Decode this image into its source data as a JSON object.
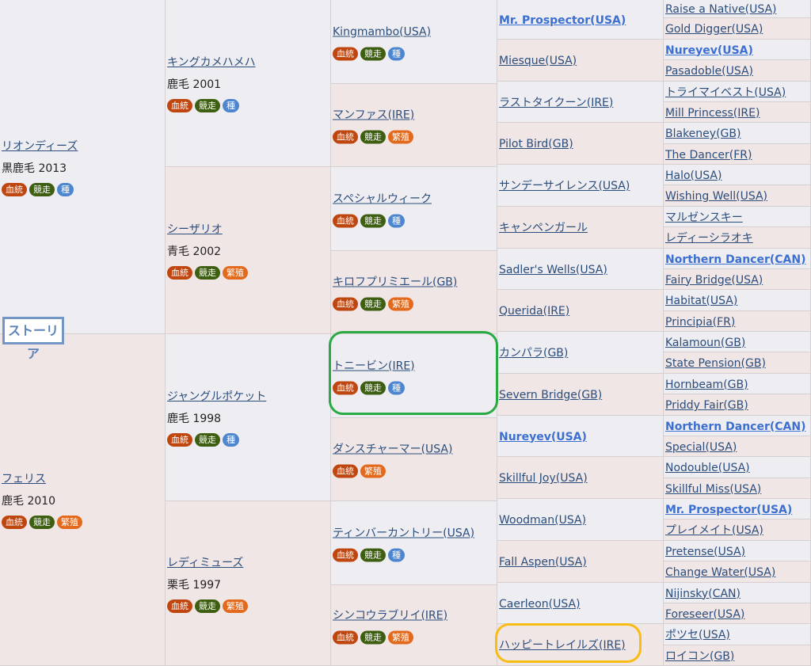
{
  "subject_label": "ストーリア",
  "gen1": [
    {
      "name": "リオンディーズ",
      "coat": "黒鹿毛 2013",
      "badges": [
        "血統",
        "競走",
        "種"
      ]
    },
    {
      "name": "フェリス",
      "coat": "鹿毛 2010",
      "badges": [
        "血統",
        "競走",
        "繁殖"
      ]
    }
  ],
  "gen2": [
    {
      "name": "キングカメハメハ",
      "coat": "鹿毛 2001",
      "badges": [
        "血統",
        "競走",
        "種"
      ]
    },
    {
      "name": "シーザリオ",
      "coat": "青毛 2002",
      "badges": [
        "血統",
        "競走",
        "繁殖"
      ]
    },
    {
      "name": "ジャングルポケット",
      "coat": "鹿毛 1998",
      "badges": [
        "血統",
        "競走",
        "種"
      ]
    },
    {
      "name": "レディミューズ",
      "coat": "栗毛 1997",
      "badges": [
        "血統",
        "競走",
        "繁殖"
      ]
    }
  ],
  "gen3": [
    {
      "name": "Kingmambo(USA)",
      "badges": [
        "血統",
        "競走",
        "種"
      ]
    },
    {
      "name": "マンファス(IRE)",
      "badges": [
        "血統",
        "競走",
        "繁殖"
      ]
    },
    {
      "name": "スペシャルウィーク",
      "badges": [
        "血統",
        "競走",
        "種"
      ]
    },
    {
      "name": "キロフプリミエール(GB)",
      "badges": [
        "血統",
        "競走",
        "繁殖"
      ]
    },
    {
      "name": "トニービン(IRE)",
      "badges": [
        "血統",
        "競走",
        "種"
      ]
    },
    {
      "name": "ダンスチャーマー(USA)",
      "badges": [
        "血統",
        "繁殖"
      ]
    },
    {
      "name": "ティンバーカントリー(USA)",
      "badges": [
        "血統",
        "競走",
        "種"
      ]
    },
    {
      "name": "シンコウラブリイ(IRE)",
      "badges": [
        "血統",
        "競走",
        "繁殖"
      ]
    }
  ],
  "gen4": [
    {
      "name": "Mr. Prospector(USA)",
      "highlight": true
    },
    {
      "name": "Miesque(USA)"
    },
    {
      "name": "ラストタイクーン(IRE)"
    },
    {
      "name": "Pilot Bird(GB)"
    },
    {
      "name": "サンデーサイレンス(USA)"
    },
    {
      "name": "キャンペンガール"
    },
    {
      "name": "Sadler's Wells(USA)"
    },
    {
      "name": "Querida(IRE)"
    },
    {
      "name": "カンパラ(GB)"
    },
    {
      "name": "Severn Bridge(GB)"
    },
    {
      "name": "Nureyev(USA)",
      "highlight": true
    },
    {
      "name": "Skillful Joy(USA)"
    },
    {
      "name": "Woodman(USA)"
    },
    {
      "name": "Fall Aspen(USA)"
    },
    {
      "name": "Caerleon(USA)"
    },
    {
      "name": "ハッピートレイルズ(IRE)"
    }
  ],
  "gen5": [
    {
      "name": "Raise a Native(USA)"
    },
    {
      "name": "Gold Digger(USA)"
    },
    {
      "name": "Nureyev(USA)",
      "highlight": true
    },
    {
      "name": "Pasadoble(USA)"
    },
    {
      "name": "トライマイベスト(USA)"
    },
    {
      "name": "Mill Princess(IRE)"
    },
    {
      "name": "Blakeney(GB)"
    },
    {
      "name": "The Dancer(FR)"
    },
    {
      "name": "Halo(USA)"
    },
    {
      "name": "Wishing Well(USA)"
    },
    {
      "name": "マルゼンスキー"
    },
    {
      "name": "レディーシラオキ"
    },
    {
      "name": "Northern Dancer(CAN)",
      "highlight": true
    },
    {
      "name": "Fairy Bridge(USA)"
    },
    {
      "name": "Habitat(USA)"
    },
    {
      "name": "Principia(FR)"
    },
    {
      "name": "Kalamoun(GB)"
    },
    {
      "name": "State Pension(GB)"
    },
    {
      "name": "Hornbeam(GB)"
    },
    {
      "name": "Priddy Fair(GB)"
    },
    {
      "name": "Northern Dancer(CAN)",
      "highlight": true
    },
    {
      "name": "Special(USA)"
    },
    {
      "name": "Nodouble(USA)"
    },
    {
      "name": "Skillful Miss(USA)"
    },
    {
      "name": "Mr. Prospector(USA)",
      "highlight": true
    },
    {
      "name": "プレイメイト(USA)"
    },
    {
      "name": "Pretense(USA)"
    },
    {
      "name": "Change Water(USA)"
    },
    {
      "name": "Nijinsky(CAN)"
    },
    {
      "name": "Foreseer(USA)"
    },
    {
      "name": "ポツセ(USA)"
    },
    {
      "name": "ロイコン(GB)"
    }
  ]
}
